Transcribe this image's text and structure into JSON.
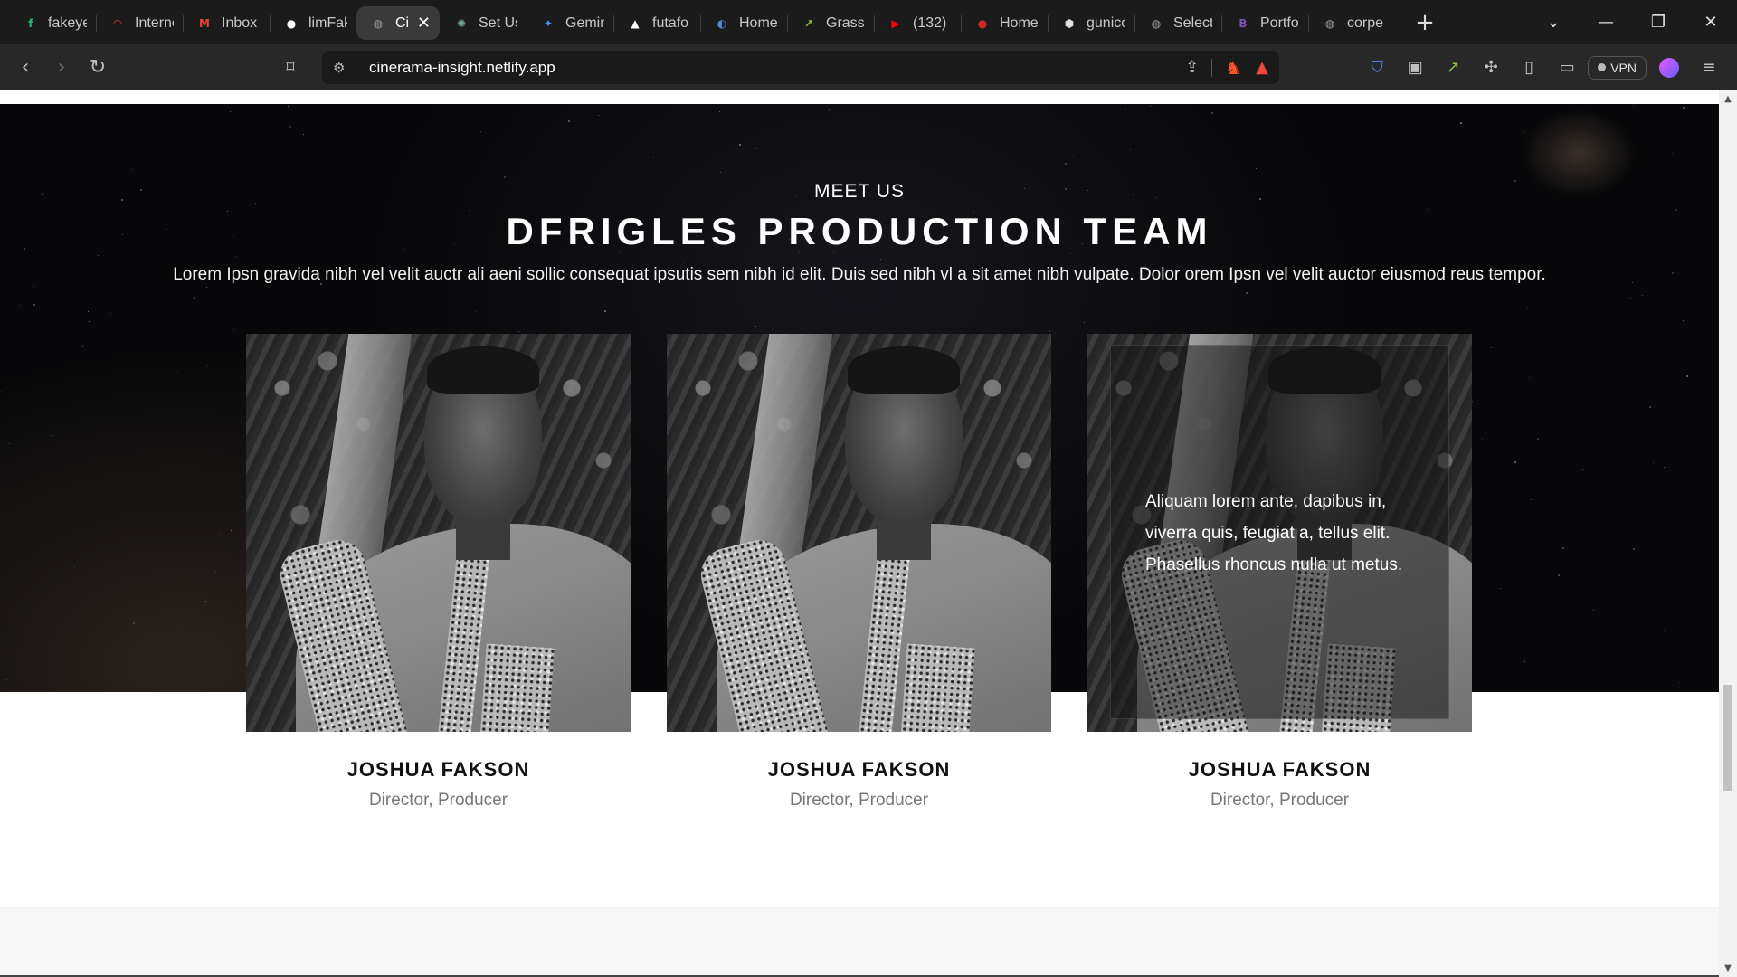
{
  "browser": {
    "tabs": [
      {
        "label": "fakeye",
        "icon": "fiverr-icon",
        "color": "#1dbf73",
        "glyph": "f"
      },
      {
        "label": "Interne",
        "icon": "gauge-icon",
        "color": "#e53935",
        "glyph": "◠"
      },
      {
        "label": "Inbox",
        "icon": "gmail-icon",
        "color": "#ea4335",
        "glyph": "M"
      },
      {
        "label": "limFak",
        "icon": "github-icon",
        "color": "#ffffff",
        "glyph": "●"
      },
      {
        "label": "Ci",
        "icon": "globe-icon",
        "color": "#9e9e9e",
        "glyph": "◍",
        "active": true
      },
      {
        "label": "Set Us",
        "icon": "openai-icon",
        "color": "#74aa9c",
        "glyph": "✺"
      },
      {
        "label": "Gemin",
        "icon": "gemini-icon",
        "color": "#4f8ef7",
        "glyph": "✦"
      },
      {
        "label": "futafo",
        "icon": "vercel-icon",
        "color": "#ffffff",
        "glyph": "▲"
      },
      {
        "label": "Home",
        "icon": "python-icon",
        "color": "#5b8bd1",
        "glyph": "◐"
      },
      {
        "label": "Grass",
        "icon": "grass-icon",
        "color": "#8bc34a",
        "glyph": "↗"
      },
      {
        "label": "(132)",
        "icon": "youtube-icon",
        "color": "#ff0000",
        "glyph": "▶"
      },
      {
        "label": "Home",
        "icon": "pin-icon",
        "color": "#c62828",
        "glyph": "●"
      },
      {
        "label": "gunico",
        "icon": "shield-icon",
        "color": "#e0e0e0",
        "glyph": "⬢"
      },
      {
        "label": "Select",
        "icon": "globe-icon",
        "color": "#9e9e9e",
        "glyph": "◍"
      },
      {
        "label": "Portfo",
        "icon": "bootstrap-icon",
        "color": "#7952b3",
        "glyph": "B"
      },
      {
        "label": "corpe",
        "icon": "globe-icon",
        "color": "#9e9e9e",
        "glyph": "◍"
      }
    ],
    "url": "cinerama-insight.netlify.app",
    "vpn_label": "VPN"
  },
  "page": {
    "eyebrow": "MEET US",
    "title": "DFRIGLES PRODUCTION TEAM",
    "intro": "Lorem Ipsn gravida nibh vel velit auctr ali aeni sollic consequat ipsutis sem nibh id elit. Duis sed nibh vl a sit amet nibh vulpate. Dolor orem Ipsn vel velit auctor eiusmod reus tempor.",
    "team": [
      {
        "name": "JOSHUA FAKSON",
        "role": "Director, Producer"
      },
      {
        "name": "JOSHUA FAKSON",
        "role": "Director, Producer"
      },
      {
        "name": "JOSHUA FAKSON",
        "role": "Director, Producer",
        "overlay": "Aliquam lorem ante, dapibus in, viverra quis, feugiat a, tellus elit. Phasellus rhoncus nulla ut metus."
      }
    ]
  }
}
